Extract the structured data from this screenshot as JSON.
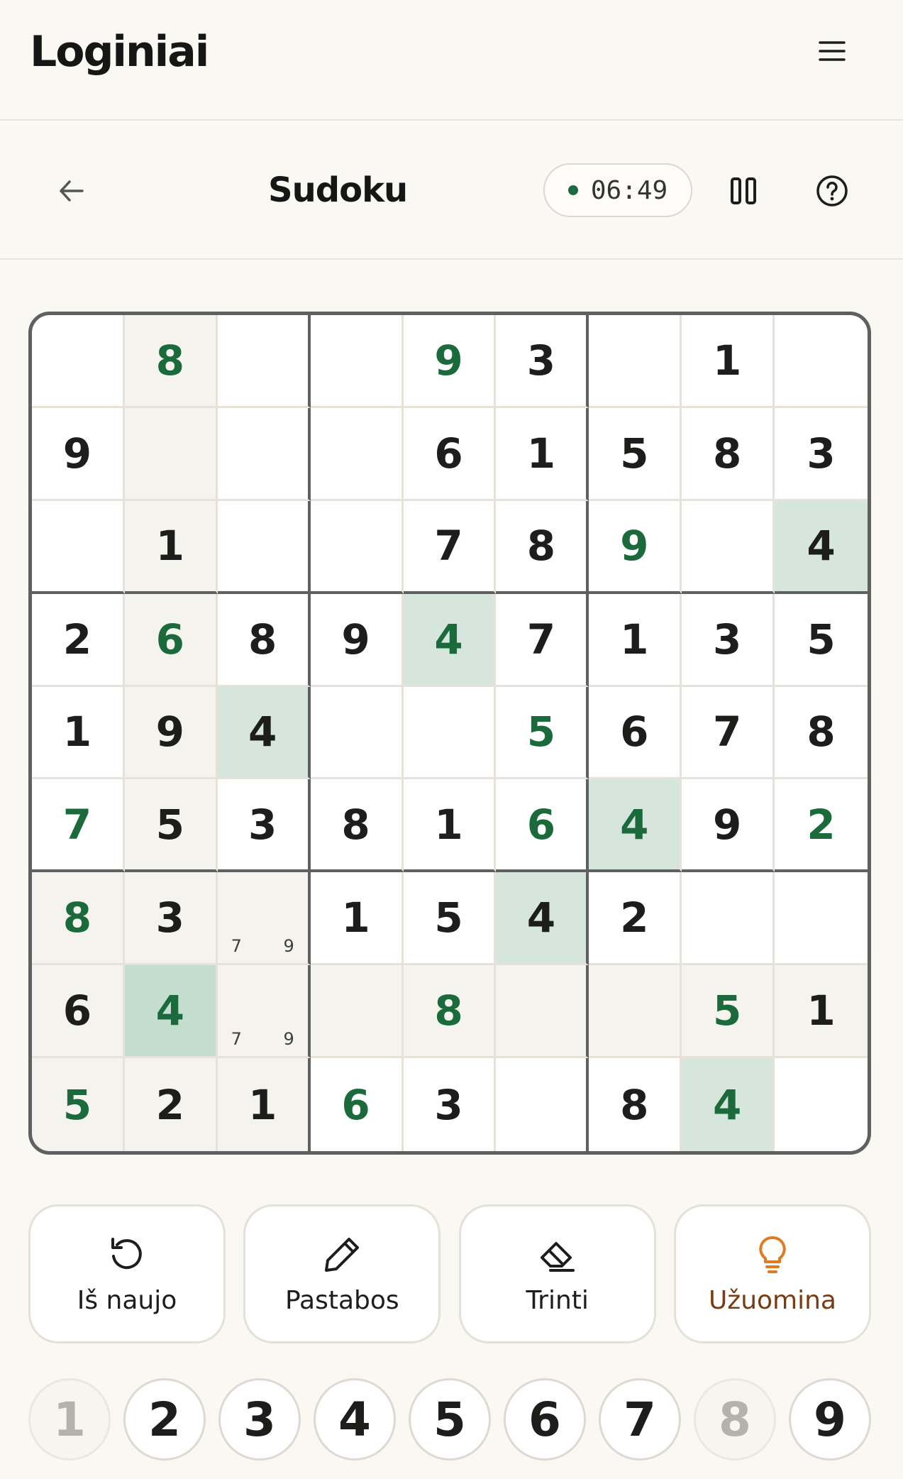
{
  "app": {
    "logo": "Loginiai"
  },
  "game_header": {
    "title": "Sudoku",
    "timer": "06:49"
  },
  "board": {
    "rows": [
      [
        "",
        "8",
        "",
        "",
        "9",
        "3",
        "",
        "1",
        ""
      ],
      [
        "9",
        "",
        "",
        "",
        "6",
        "1",
        "5",
        "8",
        "3"
      ],
      [
        "",
        "1",
        "",
        "",
        "7",
        "8",
        "9",
        "",
        "4"
      ],
      [
        "2",
        "6",
        "8",
        "9",
        "4",
        "7",
        "1",
        "3",
        "5"
      ],
      [
        "1",
        "9",
        "4",
        "",
        "",
        "5",
        "6",
        "7",
        "8"
      ],
      [
        "7",
        "5",
        "3",
        "8",
        "1",
        "6",
        "4",
        "9",
        "2"
      ],
      [
        "8",
        "3",
        "",
        "1",
        "5",
        "4",
        "2",
        "",
        ""
      ],
      [
        "6",
        "4",
        "",
        "",
        "8",
        "",
        "",
        "5",
        "1"
      ],
      [
        "5",
        "2",
        "1",
        "6",
        "3",
        "",
        "8",
        "4",
        ""
      ]
    ],
    "kinds": [
      "guggugug",
      "ggggggggg",
      "gggggguug",
      "gugguggggg",
      "gggggugggg",
      "ugggguugug",
      "ugggggggg",
      "gugguggugg",
      "uggugggugg"
    ],
    "notes": [
      {
        "row": 6,
        "col": 2,
        "values": [
          "7",
          "9"
        ]
      },
      {
        "row": 7,
        "col": 2,
        "values": [
          "7",
          "9"
        ]
      }
    ],
    "selected": {
      "row": 7,
      "col": 1
    },
    "colors": {
      "given": "#1d1d1b",
      "user": "#1b6a3c",
      "highlight_same": "#d6e6dd",
      "highlight_related": "#f5f3ee"
    }
  },
  "actions": [
    {
      "label": "Iš naujo",
      "icon": "restart-icon"
    },
    {
      "label": "Pastabos",
      "icon": "pencil-icon"
    },
    {
      "label": "Trinti",
      "icon": "eraser-icon"
    },
    {
      "label": "Užuomina",
      "icon": "lightbulb-icon",
      "accent": "#e07b1f"
    }
  ],
  "numpad": [
    {
      "label": "1",
      "disabled": true
    },
    {
      "label": "2",
      "disabled": false
    },
    {
      "label": "3",
      "disabled": false
    },
    {
      "label": "4",
      "disabled": false
    },
    {
      "label": "5",
      "disabled": false
    },
    {
      "label": "6",
      "disabled": false
    },
    {
      "label": "7",
      "disabled": false
    },
    {
      "label": "8",
      "disabled": true
    },
    {
      "label": "9",
      "disabled": false
    }
  ]
}
